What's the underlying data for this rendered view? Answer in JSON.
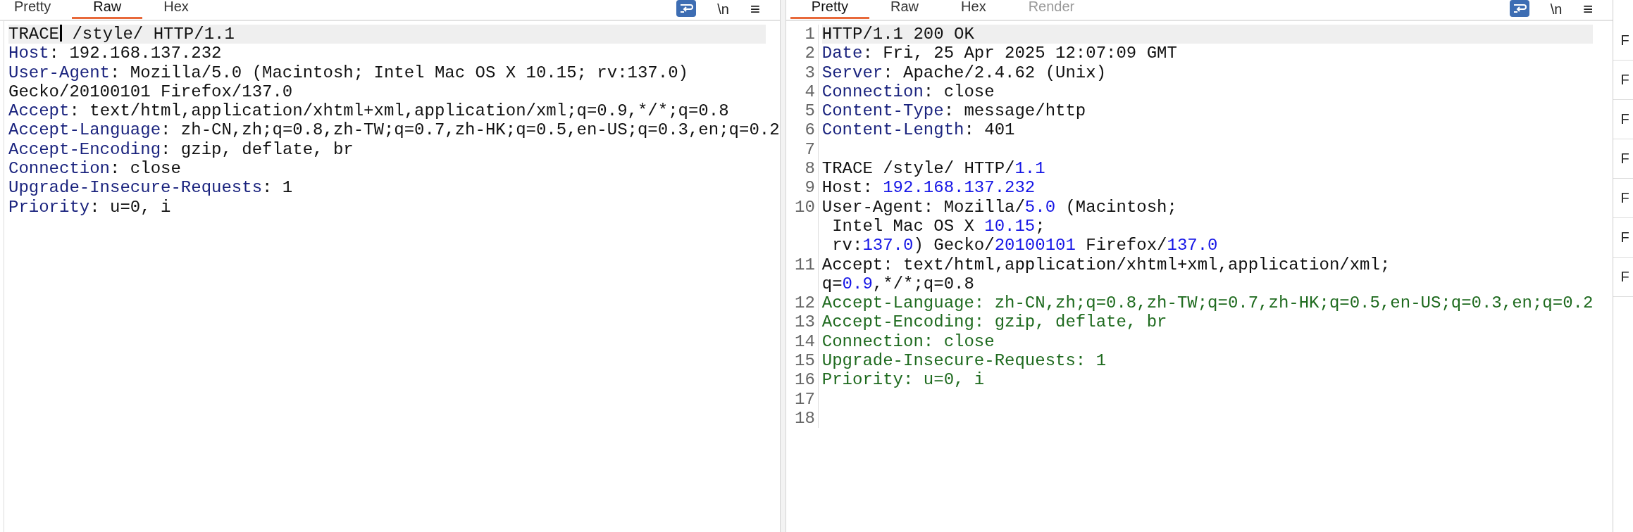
{
  "request": {
    "tabs": [
      {
        "label": "Pretty",
        "selected": false,
        "disabled": false
      },
      {
        "label": "Raw",
        "selected": true,
        "disabled": false
      },
      {
        "label": "Hex",
        "selected": false,
        "disabled": false
      }
    ],
    "toolbar": {
      "wrap_on": true,
      "newline_label": "\\n",
      "menu_label": "≡"
    },
    "lines": [
      {
        "highlighted": true,
        "rows": [
          {
            "segments": [
              {
                "text": "TRACE",
                "kind": "plain",
                "caret": true
              },
              {
                "text": " /style/ HTTP/1.1",
                "kind": "plain"
              }
            ]
          }
        ]
      },
      {
        "highlighted": false,
        "rows": [
          {
            "segments": [
              {
                "text": "Host",
                "kind": "name"
              },
              {
                "text": ": 192.168.137.232",
                "kind": "plain"
              }
            ]
          }
        ]
      },
      {
        "highlighted": false,
        "rows": [
          {
            "segments": [
              {
                "text": "User-Agent",
                "kind": "name"
              },
              {
                "text": ": Mozilla/5.0 (Macintosh; Intel Mac OS X 10.15; rv:137.0)",
                "kind": "plain"
              }
            ]
          },
          {
            "segments": [
              {
                "text": "Gecko/20100101 Firefox/137.0",
                "kind": "plain"
              }
            ]
          }
        ]
      },
      {
        "highlighted": false,
        "rows": [
          {
            "segments": [
              {
                "text": "Accept",
                "kind": "name"
              },
              {
                "text": ": text/html,application/xhtml+xml,application/xml;q=0.9,*/*;q=0.8",
                "kind": "plain"
              }
            ]
          }
        ]
      },
      {
        "highlighted": false,
        "rows": [
          {
            "segments": [
              {
                "text": "Accept-Language",
                "kind": "name"
              },
              {
                "text": ": zh-CN,zh;q=0.8,zh-TW;q=0.7,zh-HK;q=0.5,en-US;q=0.3,en;q=0.2",
                "kind": "plain"
              }
            ]
          }
        ]
      },
      {
        "highlighted": false,
        "rows": [
          {
            "segments": [
              {
                "text": "Accept-Encoding",
                "kind": "name"
              },
              {
                "text": ": gzip, deflate, br",
                "kind": "plain"
              }
            ]
          }
        ]
      },
      {
        "highlighted": false,
        "rows": [
          {
            "segments": [
              {
                "text": "Connection",
                "kind": "name"
              },
              {
                "text": ": close",
                "kind": "plain"
              }
            ]
          }
        ]
      },
      {
        "highlighted": false,
        "rows": [
          {
            "segments": [
              {
                "text": "Upgrade-Insecure-Requests",
                "kind": "name"
              },
              {
                "text": ": 1",
                "kind": "plain"
              }
            ]
          }
        ]
      },
      {
        "highlighted": false,
        "rows": [
          {
            "segments": [
              {
                "text": "Priority",
                "kind": "name"
              },
              {
                "text": ": u=0, i",
                "kind": "plain"
              }
            ]
          }
        ]
      }
    ]
  },
  "response": {
    "tabs": [
      {
        "label": "Pretty",
        "selected": true,
        "disabled": false
      },
      {
        "label": "Raw",
        "selected": false,
        "disabled": false
      },
      {
        "label": "Hex",
        "selected": false,
        "disabled": false
      },
      {
        "label": "Render",
        "selected": false,
        "disabled": true
      }
    ],
    "toolbar": {
      "wrap_on": true,
      "newline_label": "\\n",
      "menu_label": "≡"
    },
    "lines": [
      {
        "number": "1",
        "highlighted": true,
        "rows": [
          {
            "segments": [
              {
                "text": "HTTP/1.1 200 OK",
                "kind": "plain"
              }
            ]
          }
        ]
      },
      {
        "number": "2",
        "highlighted": false,
        "rows": [
          {
            "segments": [
              {
                "text": "Date",
                "kind": "name"
              },
              {
                "text": ": Fri, 25 Apr 2025 12:07:09 GMT",
                "kind": "plain"
              }
            ]
          }
        ]
      },
      {
        "number": "3",
        "highlighted": false,
        "rows": [
          {
            "segments": [
              {
                "text": "Server",
                "kind": "name"
              },
              {
                "text": ": Apache/2.4.62 (Unix)",
                "kind": "plain"
              }
            ]
          }
        ]
      },
      {
        "number": "4",
        "highlighted": false,
        "rows": [
          {
            "segments": [
              {
                "text": "Connection",
                "kind": "name"
              },
              {
                "text": ": close",
                "kind": "plain"
              }
            ]
          }
        ]
      },
      {
        "number": "5",
        "highlighted": false,
        "rows": [
          {
            "segments": [
              {
                "text": "Content-Type",
                "kind": "name"
              },
              {
                "text": ": message/http",
                "kind": "plain"
              }
            ]
          }
        ]
      },
      {
        "number": "6",
        "highlighted": false,
        "rows": [
          {
            "segments": [
              {
                "text": "Content-Length",
                "kind": "name"
              },
              {
                "text": ": 401",
                "kind": "plain"
              }
            ]
          }
        ]
      },
      {
        "number": "7",
        "highlighted": false,
        "rows": [
          {
            "segments": []
          }
        ]
      },
      {
        "number": "8",
        "highlighted": false,
        "rows": [
          {
            "segments": [
              {
                "text": "TRACE /style/ HTTP/",
                "kind": "plain"
              },
              {
                "text": "1.1",
                "kind": "number"
              }
            ]
          }
        ]
      },
      {
        "number": "9",
        "highlighted": false,
        "rows": [
          {
            "segments": [
              {
                "text": "Host: ",
                "kind": "plain"
              },
              {
                "text": "192.168.137.232",
                "kind": "number"
              }
            ]
          }
        ]
      },
      {
        "number": "10",
        "highlighted": false,
        "rows": [
          {
            "segments": [
              {
                "text": "User-Agent: Mozilla/",
                "kind": "plain"
              },
              {
                "text": "5.0",
                "kind": "number"
              },
              {
                "text": " (Macintosh;",
                "kind": "plain"
              }
            ]
          },
          {
            "segments": [
              {
                "text": " Intel Mac OS X ",
                "kind": "plain"
              },
              {
                "text": "10.15",
                "kind": "number"
              },
              {
                "text": ";",
                "kind": "plain"
              }
            ]
          },
          {
            "segments": [
              {
                "text": " rv:",
                "kind": "plain"
              },
              {
                "text": "137.0",
                "kind": "number"
              },
              {
                "text": ") Gecko/",
                "kind": "plain"
              },
              {
                "text": "20100101",
                "kind": "number"
              },
              {
                "text": " Firefox/",
                "kind": "plain"
              },
              {
                "text": "137.0",
                "kind": "number"
              }
            ]
          }
        ]
      },
      {
        "number": "11",
        "highlighted": false,
        "rows": [
          {
            "segments": [
              {
                "text": "Accept: text/html,application/xhtml+xml,application/xml;",
                "kind": "plain"
              }
            ]
          },
          {
            "segments": [
              {
                "text": "q=",
                "kind": "plain"
              },
              {
                "text": "0.9",
                "kind": "number"
              },
              {
                "text": ",*/*;q=0.8",
                "kind": "plain"
              }
            ]
          }
        ]
      },
      {
        "number": "12",
        "highlighted": false,
        "rows": [
          {
            "segments": [
              {
                "text": "Accept-Language: zh-CN,zh;q=0.8,zh-TW;q=0.7,zh-HK;q=0.5,en-US;q=0.3,en;q=0.2",
                "kind": "body"
              }
            ]
          }
        ]
      },
      {
        "number": "13",
        "highlighted": false,
        "rows": [
          {
            "segments": [
              {
                "text": "Accept-Encoding: gzip, deflate, br",
                "kind": "body"
              }
            ]
          }
        ]
      },
      {
        "number": "14",
        "highlighted": false,
        "rows": [
          {
            "segments": [
              {
                "text": "Connection: close",
                "kind": "body"
              }
            ]
          }
        ]
      },
      {
        "number": "15",
        "highlighted": false,
        "rows": [
          {
            "segments": [
              {
                "text": "Upgrade-Insecure-Requests: 1",
                "kind": "body"
              }
            ]
          }
        ]
      },
      {
        "number": "16",
        "highlighted": false,
        "rows": [
          {
            "segments": [
              {
                "text": "Priority: u=0, i",
                "kind": "body"
              }
            ]
          }
        ]
      },
      {
        "number": "17",
        "highlighted": false,
        "rows": [
          {
            "segments": []
          }
        ]
      },
      {
        "number": "18",
        "highlighted": false,
        "rows": [
          {
            "segments": []
          }
        ]
      }
    ]
  },
  "side_column": {
    "items": [
      "F",
      "F",
      "F",
      "F",
      "F",
      "F",
      "F"
    ]
  }
}
